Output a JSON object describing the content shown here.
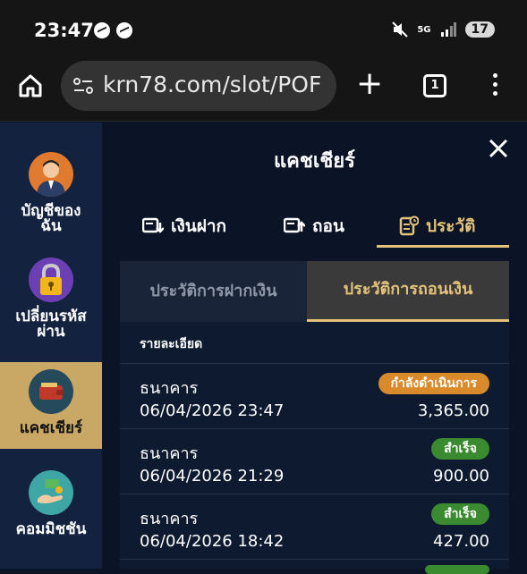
{
  "status_bar": {
    "time": "23:47",
    "network": "5G",
    "battery": "17"
  },
  "browser": {
    "url": "krn78.com/slot/POF",
    "tab_count": "1"
  },
  "sidebar": {
    "items": [
      {
        "label": "บัญชีของฉัน",
        "icon": "user-avatar-icon"
      },
      {
        "label": "เปลี่ยนรหัสผ่าน",
        "icon": "lock-icon"
      },
      {
        "label": "แคชเชียร์",
        "icon": "wallet-icon"
      },
      {
        "label": "คอมมิชชัน",
        "icon": "commission-icon"
      }
    ]
  },
  "panel": {
    "title": "แคชเชียร์",
    "tabs": [
      {
        "label": "เงินฝาก",
        "icon": "deposit-icon"
      },
      {
        "label": "ถอน",
        "icon": "withdraw-icon"
      },
      {
        "label": "ประวัติ",
        "icon": "history-icon"
      }
    ],
    "subtabs": [
      {
        "label": "ประวัติการฝากเงิน"
      },
      {
        "label": "ประวัติการถอนเงิน"
      }
    ],
    "list_header": "รายละเอียด",
    "rows": [
      {
        "label": "ธนาคาร",
        "datetime": "06/04/2026 23:47",
        "status": "กำลังดำเนินการ",
        "amount": "3,365.00"
      },
      {
        "label": "ธนาคาร",
        "datetime": "06/04/2026 21:29",
        "status": "สำเร็จ",
        "amount": "900.00"
      },
      {
        "label": "ธนาคาร",
        "datetime": "06/04/2026 18:42",
        "status": "สำเร็จ",
        "amount": "427.00"
      }
    ]
  },
  "colors": {
    "accent": "#e3c27a",
    "pending": "#d98a2b",
    "success": "#3a8a2f",
    "sidebar_active": "#c9a866"
  }
}
